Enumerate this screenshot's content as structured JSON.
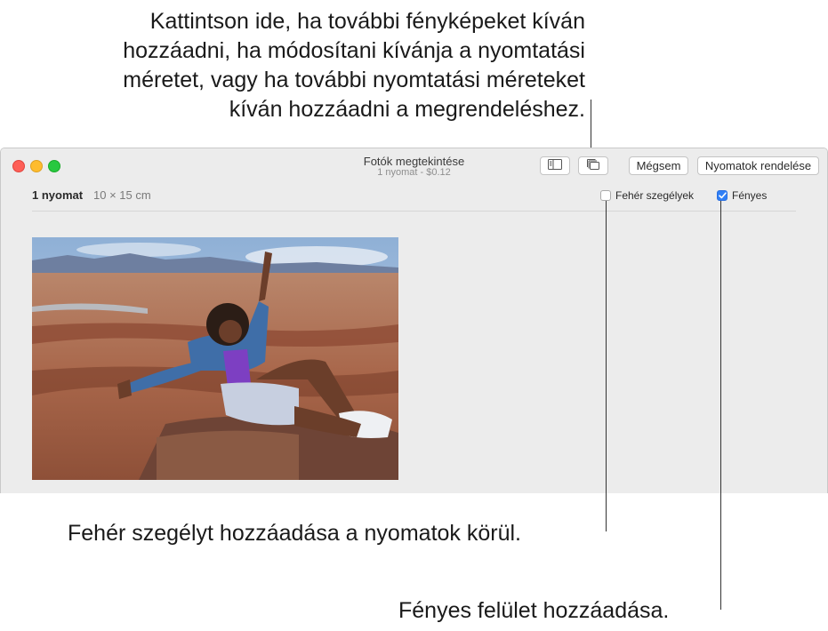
{
  "callouts": {
    "top": [
      "Kattintson ide, ha további fényképeket kíván",
      "hozzáadni, ha módosítani kívánja a nyomtatási",
      "méretet, vagy ha további nyomtatási méreteket",
      "kíván hozzáadni a megrendeléshez."
    ],
    "borders": "Fehér szegélyt hozzáadása a nyomatok körül.",
    "glossy": "Fényes felület hozzáadása."
  },
  "window": {
    "title": "Fotók megtekintése",
    "subtitle": "1 nyomat - $0.12"
  },
  "toolbar": {
    "sidebar_icon": "sidebar-icon",
    "stack_icon": "photo-stack-icon",
    "cancel_label": "Mégsem",
    "order_label": "Nyomatok rendelése"
  },
  "info": {
    "count": "1 nyomat",
    "size": "10 × 15 cm"
  },
  "options": {
    "white_borders": {
      "label": "Fehér szegélyek",
      "checked": false
    },
    "glossy": {
      "label": "Fényes",
      "checked": true
    }
  },
  "colors": {
    "accent": "#2f7ff6",
    "close": "#fe5f57",
    "minimize": "#febc2e",
    "maximize": "#28c840"
  }
}
